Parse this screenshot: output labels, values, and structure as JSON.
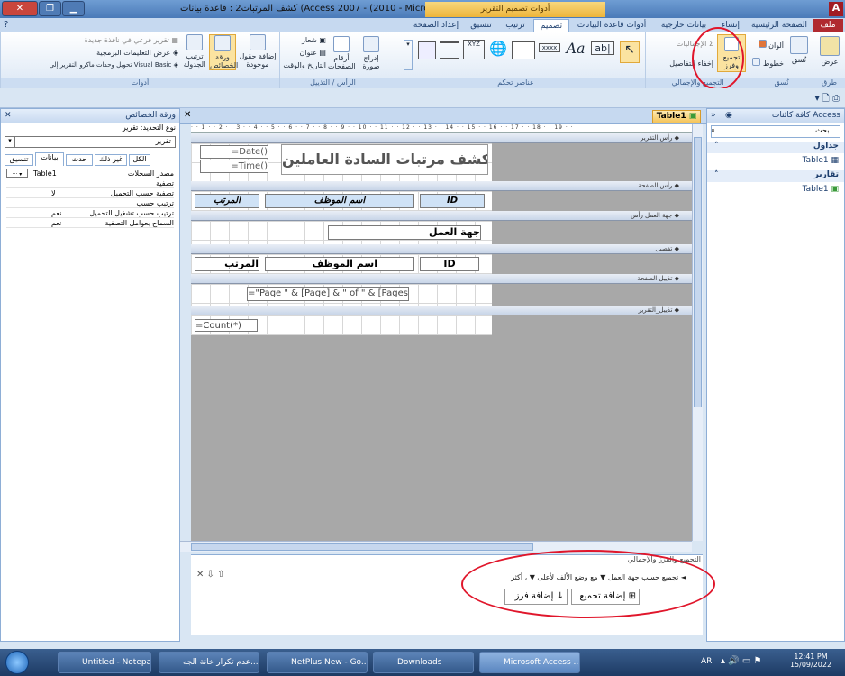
{
  "window": {
    "title": "كشف المرتبات2 : قاعدة بيانات (Access 2007 - (2010 - Microsoft Access",
    "context_tab": "أدوات تصميم التقرير"
  },
  "ribbon_tabs": [
    "ملف",
    "الصفحة الرئيسية",
    "إنشاء",
    "بيانات خارجية",
    "أدوات قاعدة البيانات",
    "تصميم",
    "ترتيب",
    "تنسيق",
    "إعداد الصفحة"
  ],
  "ribbon": {
    "views": {
      "label": "عرض",
      "group": "طرق عرض"
    },
    "themes": {
      "items": [
        "نُسق",
        "ألوان",
        "خطوط"
      ],
      "group": "نُسق"
    },
    "grouping": {
      "btn": "تجميع وفرز",
      "items": [
        "الإجماليات",
        "إخفاء التفاصيل"
      ],
      "group": "التجميع والإجمالي"
    },
    "controls": {
      "group": "عناصر تحكم",
      "aa": "Aa",
      "ab": "ab|",
      "xxxx": "xxxx",
      "xyz": "XYZ"
    },
    "header_footer": {
      "items": [
        "إدراج صورة",
        "أرقام الصفحات",
        "شعار",
        "عنوان",
        "التاريخ والوقت"
      ],
      "group": "الرأس / التذييل"
    },
    "tools": {
      "items": [
        "إضافة حقول موجودة",
        "ورقة الخصائص",
        "ترتيب الجدولة",
        "تقرير فرعي في نافذة جديدة",
        "عرض التعليمات البرمجية",
        "تحويل وحدات ماكرو التقرير إلى Visual Basic"
      ],
      "group": "أدوات"
    }
  },
  "nav": {
    "header": "كافة كائنات Access",
    "search": "بحث...",
    "tables_label": "جداول",
    "tables": [
      "Table1"
    ],
    "reports_label": "تقارير",
    "reports": [
      "Table1"
    ]
  },
  "doc_tab": "Table1",
  "props": {
    "title": "ورقة الخصائص",
    "sel_type": "نوع التحديد: تقرير",
    "combo": "تقرير",
    "tabs": [
      "تنسيق",
      "بيانات",
      "حدث",
      "غير ذلك",
      "الكل"
    ],
    "rows": [
      {
        "name": "مصدر السجلات",
        "value": "Table1"
      },
      {
        "name": "تصفية",
        "value": ""
      },
      {
        "name": "تصفية حسب التحميل",
        "value": "لا"
      },
      {
        "name": "ترتيب حسب",
        "value": ""
      },
      {
        "name": "ترتيب حسب تشغيل التحميل",
        "value": "نعم"
      },
      {
        "name": "السماح بعوامل التصفية",
        "value": "نعم"
      }
    ]
  },
  "design": {
    "ruler": "· · 1 · · 2 · · 3 · · 4 · · 5 · · 6 · · 7 · · 8 · · 9 · · 10 · · 11 · · 12 · · 13 · · 14 · · 15 · · 16 · · 17 · · 18 · · 19 · ·",
    "bands": [
      "رأس التقرير",
      "رأس الصفحة",
      "جهة العمل رأس",
      "تفصيل",
      "تذييل الصفحة",
      "تذييل_التقرير"
    ],
    "report_title": "كشف مرتبات السادة العاملين",
    "date": "=Date()",
    "time": "=Time()",
    "ph": [
      "ID",
      "اسم الموظف",
      "المرتب"
    ],
    "group_field": "جهة العمل",
    "detail": [
      "ID",
      "اسم الموظف",
      "المرتب"
    ],
    "page_expr": "=\"Page \" & [Page] & \" of \" & [Pages]",
    "count": "=Count(*)"
  },
  "groupbar": {
    "title": "التجميع والفرز والإجمالي",
    "line": "تجميع حسب جهة العمل  ▼  مع وضع الألف لأعلى  ▼ ، أكثر ◄",
    "add_group": "إضافة تجميع",
    "add_sort": "إضافة فرز"
  },
  "taskbar": {
    "items": [
      "Untitled - Notepad",
      "عدم تكرار خانة الجه...",
      "NetPlus New - Go...",
      "Downloads",
      "Microsoft Access ..."
    ],
    "lang": "AR",
    "time": "12:41 PM",
    "date": "15/09/2022"
  }
}
